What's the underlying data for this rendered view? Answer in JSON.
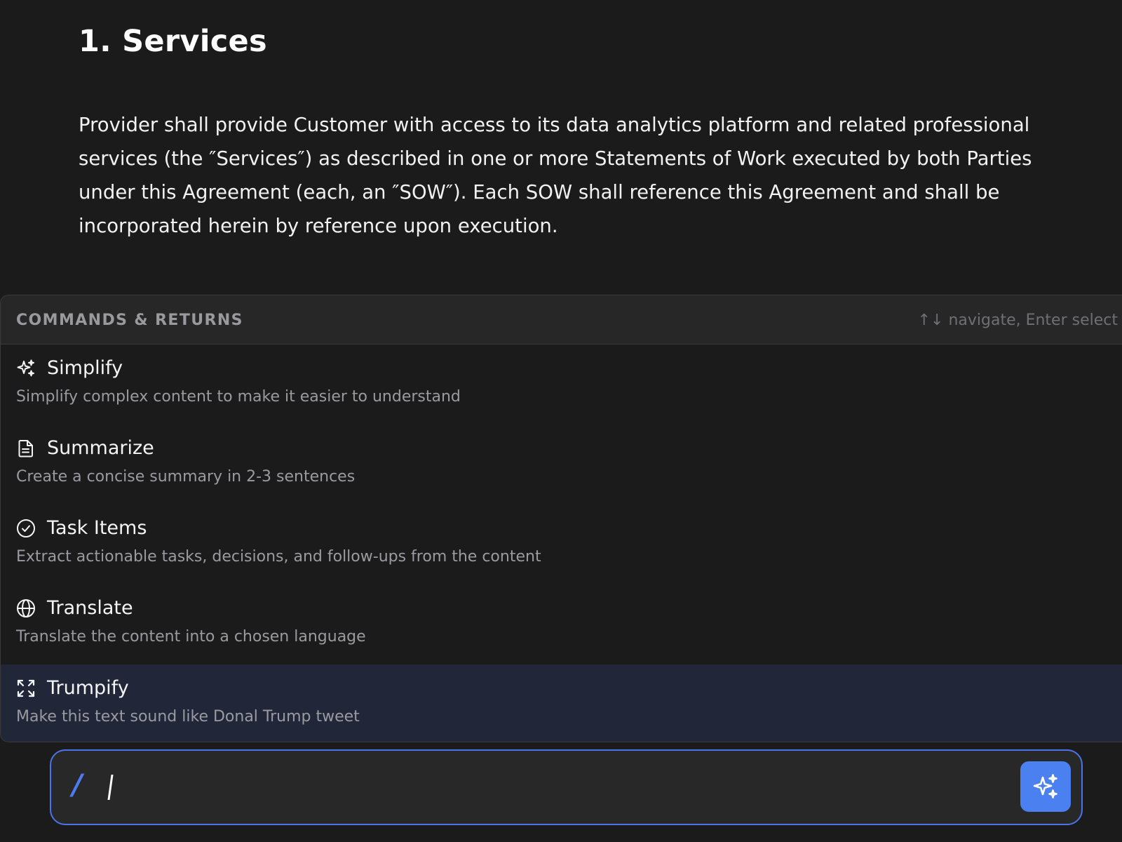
{
  "document": {
    "heading": "1. Services",
    "paragraph": "Provider shall provide Customer with access to its data analytics platform and related professional services (the ″Services″) as described in one or more Statements of Work executed by both Parties under this Agreement (each, an ″SOW″). Each SOW shall reference this Agreement and shall be incorporated herein by reference upon execution."
  },
  "command_panel": {
    "title": "COMMANDS & RETURNS",
    "hint": "↑↓ navigate, Enter select",
    "items": [
      {
        "name": "Simplify",
        "description": "Simplify complex content to make it easier to understand",
        "icon": "sparkles-icon",
        "selected": false
      },
      {
        "name": "Summarize",
        "description": "Create a concise summary in 2-3 sentences",
        "icon": "document-icon",
        "selected": false
      },
      {
        "name": "Task Items",
        "description": "Extract actionable tasks, decisions, and follow-ups from the content",
        "icon": "check-circle-icon",
        "selected": false
      },
      {
        "name": "Translate",
        "description": "Translate the content into a chosen language",
        "icon": "globe-icon",
        "selected": false
      },
      {
        "name": "Trumpify",
        "description": "Make this text sound like Donal Trump tweet",
        "icon": "expand-icon",
        "selected": true
      }
    ]
  },
  "input": {
    "prefix": "/",
    "value": "",
    "submit_icon": "sparkles-icon"
  },
  "colors": {
    "background": "#1b1b1c",
    "panel_header": "#272728",
    "selected_row": "#212739",
    "accent": "#4a80f0"
  }
}
